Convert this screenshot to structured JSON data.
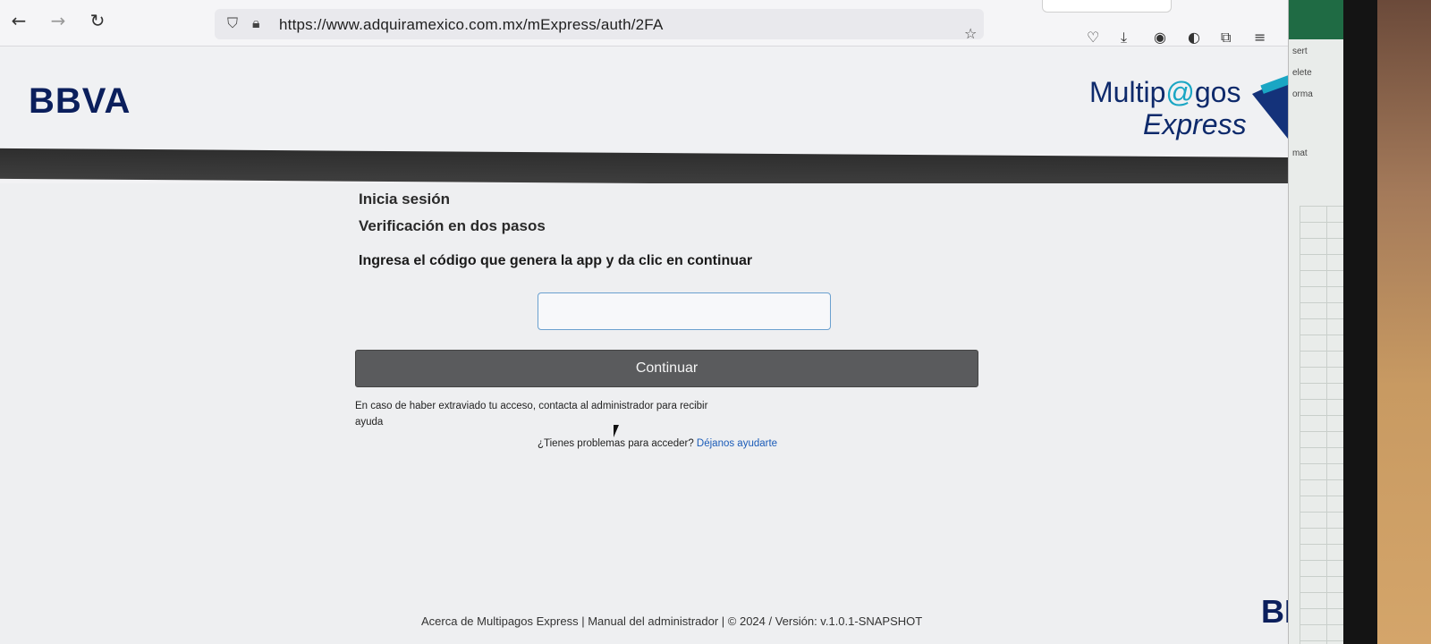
{
  "browser": {
    "url": "https://www.adquiramexico.com.mx/mExpress/auth/2FA",
    "back_icon": "arrow-left",
    "forward_icon": "arrow-right",
    "reload_icon": "reload",
    "shield_icon": "shield",
    "lock_icon": "lock",
    "bookmark_icon": "star"
  },
  "header": {
    "bbva_logo": "BBVA",
    "product_line1_a": "Multip",
    "product_line1_at": "@",
    "product_line1_b": "gos",
    "product_line2": "Express"
  },
  "form": {
    "title": "Inicia sesión",
    "subtitle": "Verificación en dos pasos",
    "instruction": "Ingresa el código que genera la app y da clic en continuar",
    "code_value": "",
    "continue_label": "Continuar",
    "help_text": "En caso de haber extraviado tu acceso, contacta al administrador para recibir ayuda",
    "problems_text": "¿Tienes problemas para acceder?",
    "problems_link": "Déjanos ayudarte"
  },
  "footer": {
    "about_link": "Acerca de Multipagos Express",
    "separator1": " | ",
    "manual_link": "Manual del administrador",
    "separator2": " | ",
    "copyright": "© 2024 / Versión: v.1.0.1-SNAPSHOT",
    "bbva_logo": "BBV"
  },
  "background_window": {
    "menu": [
      "sert",
      "elete",
      "orma",
      "mat"
    ]
  },
  "colors": {
    "brand_navy": "#0b1f5c",
    "brand_cyan": "#1aa6c4",
    "button_gray": "#5a5b5d",
    "link_blue": "#1a5bb8"
  }
}
